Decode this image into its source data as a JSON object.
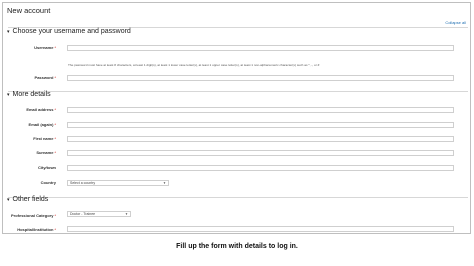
{
  "form": {
    "title": "New account",
    "collapse_label": "Collapse all",
    "sections": {
      "credentials": "Choose your username and password",
      "details": "More details",
      "other": "Other fields"
    },
    "required_mark": "*",
    "fields": {
      "username": {
        "label": "Username",
        "value": ""
      },
      "password_help": "The password must have at least 8 characters, at least 1 digit(s), at least 1 lower case letter(s), at least 1 upper case letter(s), at least 1 non-alphanumeric character(s) such as *, -, or #",
      "password": {
        "label": "Password",
        "value": ""
      },
      "email": {
        "label": "Email address",
        "value": ""
      },
      "email_again": {
        "label": "Email (again)",
        "value": ""
      },
      "first_name": {
        "label": "First name",
        "value": ""
      },
      "surname": {
        "label": "Surname",
        "value": ""
      },
      "city": {
        "label": "City/town",
        "value": ""
      },
      "country": {
        "label": "Country",
        "selected": "Select a country"
      },
      "professional_category": {
        "label": "Professional Category",
        "selected": "Doctor - Trainee"
      },
      "hospital": {
        "label": "Hospital/Institution",
        "value": ""
      }
    }
  },
  "caption": "Fill up the form with details to log in."
}
